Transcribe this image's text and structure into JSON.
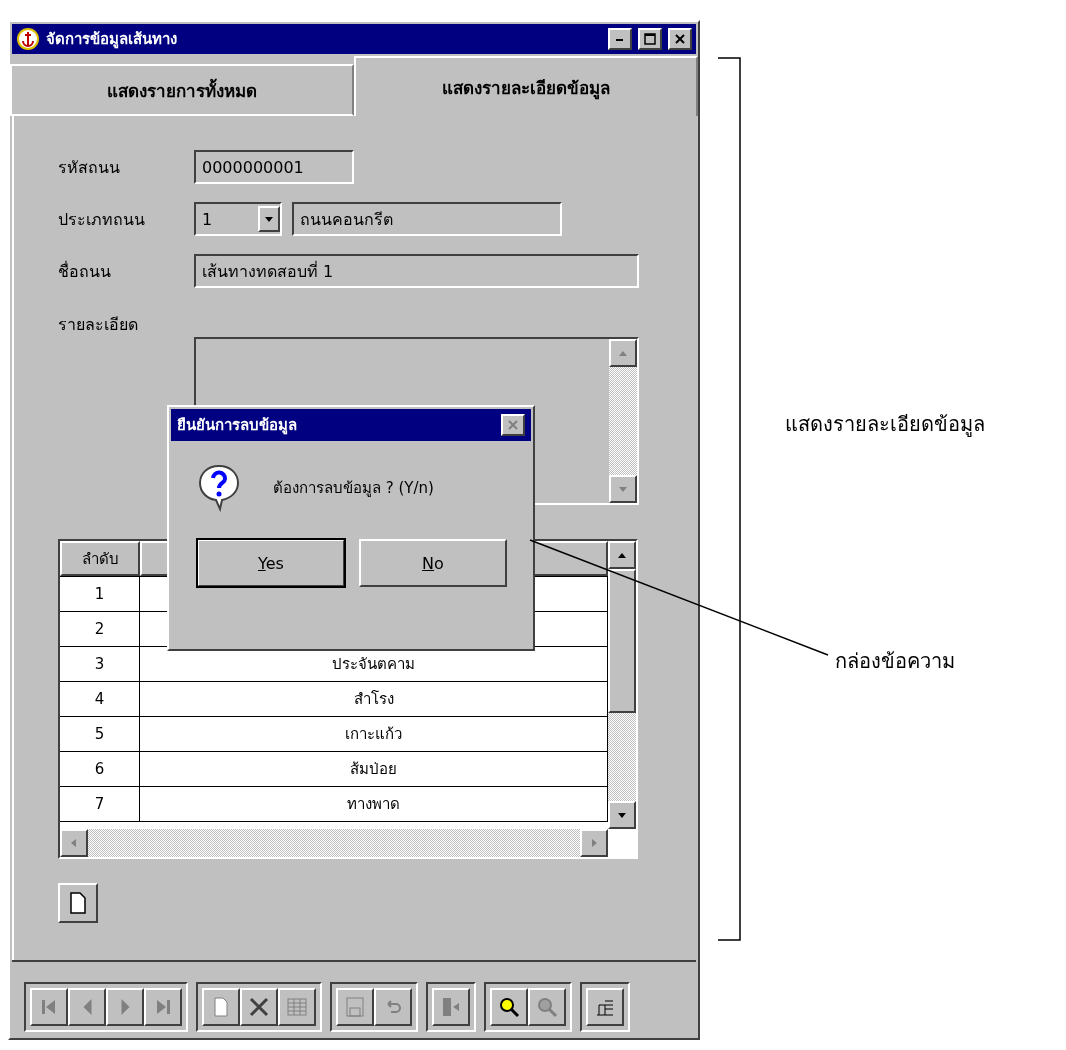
{
  "window": {
    "title": "จัดการข้อมูลเส้นทาง"
  },
  "tabs": [
    {
      "label": "แสดงรายการทั้งหมด",
      "selected": false
    },
    {
      "label": "แสดงรายละเอียดข้อมูล",
      "selected": true
    }
  ],
  "form": {
    "code_label": "รหัสถนน",
    "code_value": "0000000001",
    "type_label": "ประเภทถนน",
    "type_value": "1",
    "type_name": "ถนนคอนกรีต",
    "name_label": "ชื่อถนน",
    "name_value": "เส้นทางทดสอบที่ 1",
    "detail_label": "รายละเอียด"
  },
  "table": {
    "columns": [
      "ลำดับ"
    ],
    "rows": [
      {
        "no": "1"
      },
      {
        "no": "2"
      },
      {
        "no": "3",
        "name": "ประจันตคาม"
      },
      {
        "no": "4",
        "name": "สำโรง"
      },
      {
        "no": "5",
        "name": "เกาะแก้ว"
      },
      {
        "no": "6",
        "name": "ส้มป่อย"
      },
      {
        "no": "7",
        "name": "ทางพาด"
      }
    ]
  },
  "dialog": {
    "title": "ยืนยันการลบข้อมูล",
    "message": "ต้องการลบข้อมูล ? (Y/n)",
    "buttons": [
      {
        "label": "Yes",
        "selected": true
      },
      {
        "label": "No",
        "selected": false
      }
    ]
  },
  "toolbar": [
    [
      {
        "kind": "first",
        "disabled": true
      },
      {
        "kind": "prev",
        "disabled": true
      },
      {
        "kind": "next",
        "disabled": true
      },
      {
        "kind": "last",
        "disabled": true
      }
    ],
    [
      {
        "kind": "new",
        "disabled": true
      },
      {
        "kind": "delete",
        "disabled": false
      },
      {
        "kind": "grid",
        "disabled": true
      }
    ],
    [
      {
        "kind": "save",
        "disabled": true
      },
      {
        "kind": "undo",
        "disabled": true
      }
    ],
    [
      {
        "kind": "exit",
        "disabled": true
      }
    ],
    [
      {
        "kind": "search",
        "disabled": false
      },
      {
        "kind": "search",
        "disabled": true
      }
    ],
    [
      {
        "kind": "report",
        "disabled": false
      }
    ]
  ],
  "annotations": [
    {
      "text": "แสดงรายละเอียดข้อมูล"
    },
    {
      "text": "กล่องข้อความ"
    }
  ]
}
